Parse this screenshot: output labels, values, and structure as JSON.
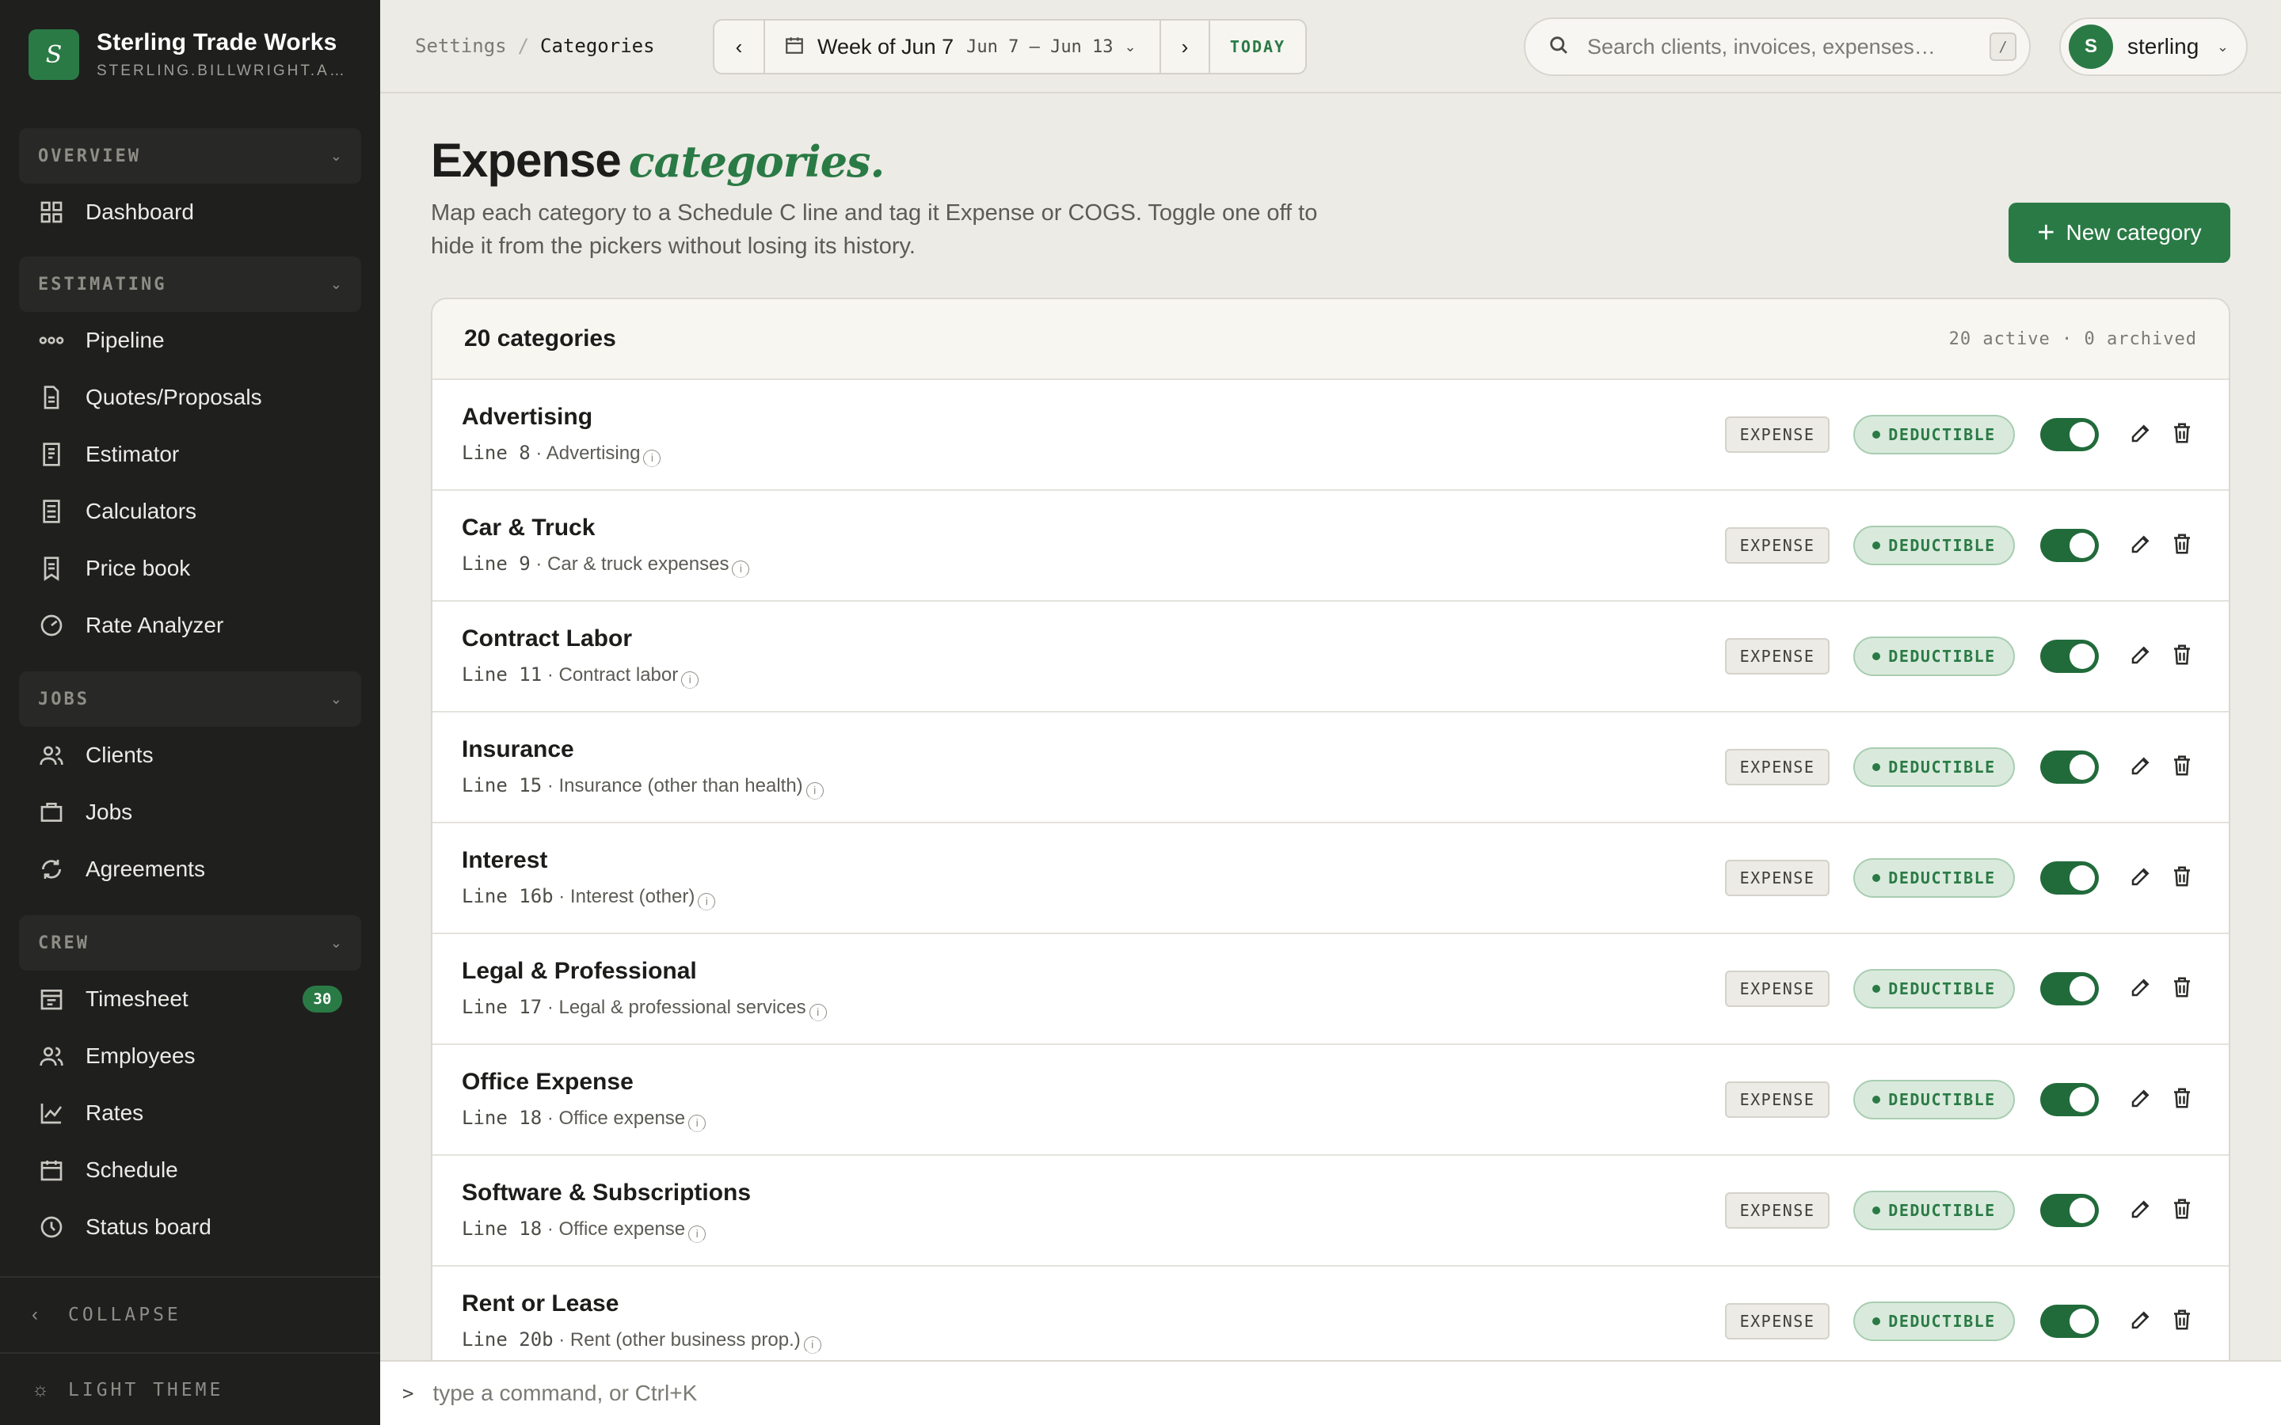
{
  "brand": {
    "logo_letter": "S",
    "name": "Sterling Trade Works",
    "domain": "STERLING.BILLWRIGHT.A…"
  },
  "nav": {
    "sections": [
      {
        "label": "OVERVIEW",
        "items": [
          {
            "label": "Dashboard",
            "icon": "grid-icon"
          }
        ]
      },
      {
        "label": "ESTIMATING",
        "items": [
          {
            "label": "Pipeline",
            "icon": "pipeline-icon"
          },
          {
            "label": "Quotes/Proposals",
            "icon": "document-icon"
          },
          {
            "label": "Estimator",
            "icon": "receipt-icon"
          },
          {
            "label": "Calculators",
            "icon": "calculator-icon"
          },
          {
            "label": "Price book",
            "icon": "book-icon"
          },
          {
            "label": "Rate Analyzer",
            "icon": "gauge-icon"
          }
        ]
      },
      {
        "label": "JOBS",
        "items": [
          {
            "label": "Clients",
            "icon": "users-icon"
          },
          {
            "label": "Jobs",
            "icon": "briefcase-icon"
          },
          {
            "label": "Agreements",
            "icon": "refresh-icon"
          }
        ]
      },
      {
        "label": "CREW",
        "items": [
          {
            "label": "Timesheet",
            "icon": "timesheet-icon",
            "badge": "30"
          },
          {
            "label": "Employees",
            "icon": "users-icon"
          },
          {
            "label": "Rates",
            "icon": "chart-icon"
          },
          {
            "label": "Schedule",
            "icon": "calendar-icon"
          },
          {
            "label": "Status board",
            "icon": "clock-icon"
          }
        ]
      }
    ],
    "collapse_label": "COLLAPSE",
    "theme_label": "LIGHT THEME"
  },
  "topbar": {
    "breadcrumb": [
      "Settings",
      "Categories"
    ],
    "breadcrumb_sep": "/",
    "week_label": "Week of Jun 7",
    "week_range": "Jun 7 – Jun 13",
    "today_label": "TODAY",
    "search_placeholder": "Search clients, invoices, expenses…",
    "search_shortcut": "/",
    "user_initial": "S",
    "user_name": "sterling"
  },
  "page": {
    "title_main": "Expense",
    "title_accent": "categories.",
    "description": "Map each category to a Schedule C line and tag it Expense or COGS. Toggle one off to hide it from the pickers without losing its history.",
    "new_button": "New category"
  },
  "panel": {
    "count_label": "20 categories",
    "stats_label": "20 active · 0 archived",
    "rows": [
      {
        "name": "Advertising",
        "line": "Line  8",
        "desc": "Advertising",
        "type": "EXPENSE",
        "tax": "DEDUCTIBLE",
        "enabled": true
      },
      {
        "name": "Car & Truck",
        "line": "Line  9",
        "desc": "Car & truck expenses",
        "type": "EXPENSE",
        "tax": "DEDUCTIBLE",
        "enabled": true
      },
      {
        "name": "Contract Labor",
        "line": "Line  11",
        "desc": "Contract labor",
        "type": "EXPENSE",
        "tax": "DEDUCTIBLE",
        "enabled": true
      },
      {
        "name": "Insurance",
        "line": "Line  15",
        "desc": "Insurance (other than health)",
        "type": "EXPENSE",
        "tax": "DEDUCTIBLE",
        "enabled": true
      },
      {
        "name": "Interest",
        "line": "Line  16b",
        "desc": "Interest (other)",
        "type": "EXPENSE",
        "tax": "DEDUCTIBLE",
        "enabled": true
      },
      {
        "name": "Legal & Professional",
        "line": "Line  17",
        "desc": "Legal & professional services",
        "type": "EXPENSE",
        "tax": "DEDUCTIBLE",
        "enabled": true
      },
      {
        "name": "Office Expense",
        "line": "Line  18",
        "desc": "Office expense",
        "type": "EXPENSE",
        "tax": "DEDUCTIBLE",
        "enabled": true
      },
      {
        "name": "Software & Subscriptions",
        "line": "Line  18",
        "desc": "Office expense",
        "type": "EXPENSE",
        "tax": "DEDUCTIBLE",
        "enabled": true
      },
      {
        "name": "Rent or Lease",
        "line": "Line  20b",
        "desc": "Rent (other business prop.)",
        "type": "EXPENSE",
        "tax": "DEDUCTIBLE",
        "enabled": true
      }
    ]
  },
  "cmdbar": {
    "prompt": ">",
    "placeholder": "type a command, or Ctrl+K"
  },
  "colors": {
    "accent": "#2a7a45",
    "sidebar_bg": "#1f1f1e",
    "page_bg": "#ecebe5"
  }
}
